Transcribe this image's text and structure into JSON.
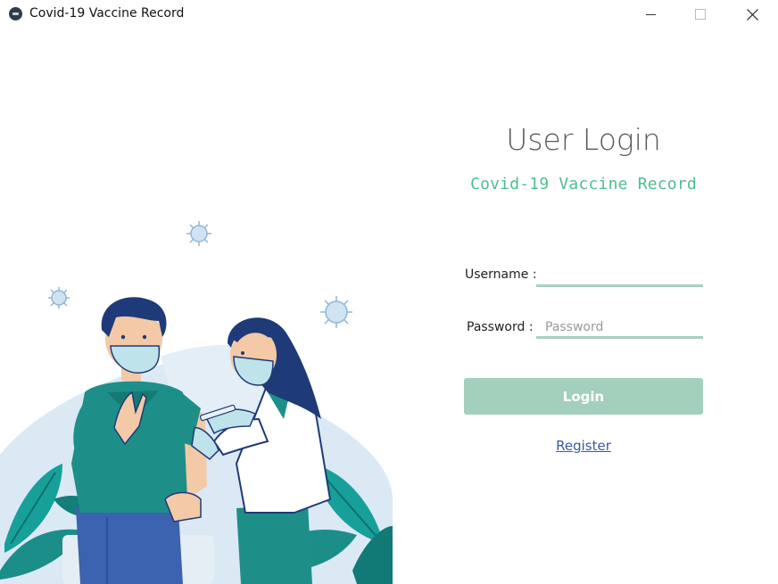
{
  "window": {
    "title": "Covid-19 Vaccine Record",
    "icon": "app-logo-icon",
    "controls": [
      "minimize-icon",
      "maximize-icon",
      "close-icon"
    ]
  },
  "login": {
    "title": "User Login",
    "subtitle": "Covid-19 Vaccine Record",
    "username_label": "Username :",
    "username_value": "",
    "username_placeholder": "",
    "password_label": "Password :",
    "password_value": "",
    "password_placeholder": "Password",
    "login_button": "Login",
    "register_link": "Register"
  },
  "illustration": {
    "subject": "vaccination-illustration",
    "icons": [
      "virus-icon",
      "virus-icon",
      "virus-icon"
    ]
  },
  "colors": {
    "accent_green": "#4fbf8c",
    "button_bg": "#a3cfbd",
    "input_underline": "#a7d1c1",
    "link": "#3a5a9e",
    "title_gray": "#5a5a5a"
  }
}
